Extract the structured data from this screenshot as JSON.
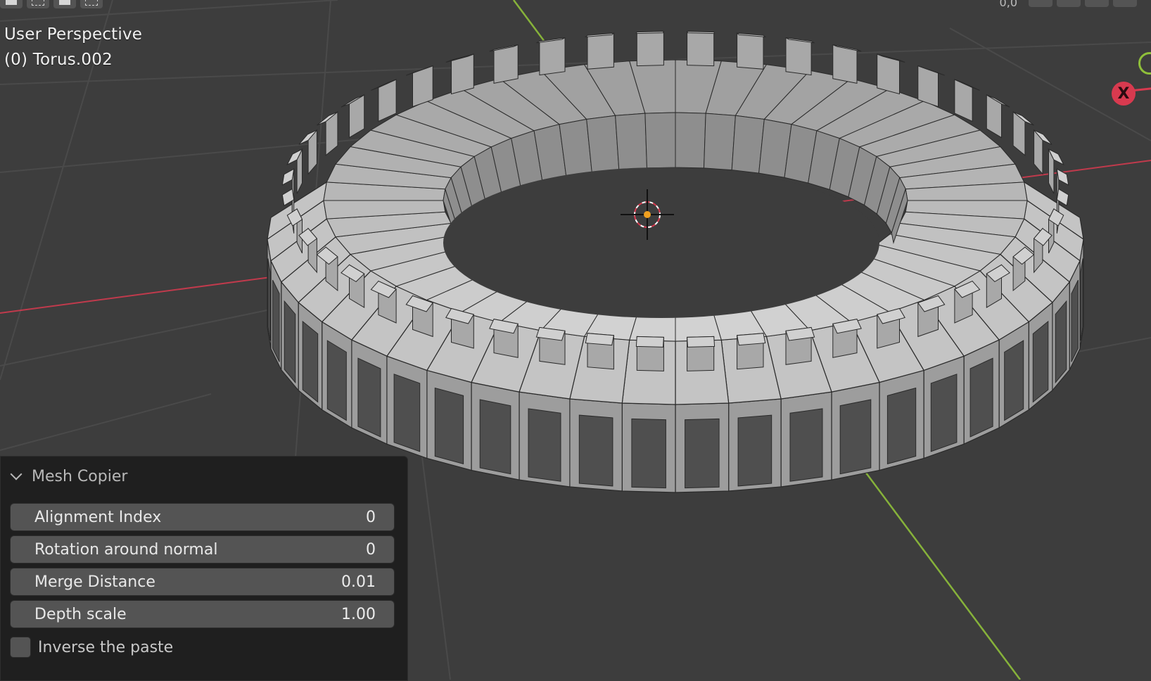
{
  "viewport": {
    "view_name": "User Perspective",
    "object_name": "(0) Torus.002",
    "top_right_readout": "0,0",
    "axis_x_label": "X",
    "icons": {
      "cursor": "3d-cursor-icon",
      "gizmo_x": "axis-x-icon",
      "gizmo_y": "axis-y-icon"
    },
    "colors": {
      "background": "#3d3d3d",
      "axis_x": "#d83a4f",
      "axis_y": "#8fbf3a",
      "grid": "#4a4a4a",
      "mesh_face": "#b9b9b9",
      "mesh_edge": "#2a2a2a"
    }
  },
  "panel": {
    "title": "Mesh Copier",
    "fields": [
      {
        "label": "Alignment Index",
        "value": "0"
      },
      {
        "label": "Rotation around normal",
        "value": "0"
      },
      {
        "label": "Merge Distance",
        "value": "0.01"
      },
      {
        "label": "Depth scale",
        "value": "1.00"
      }
    ],
    "checkbox_label": "Inverse the paste",
    "checkbox_checked": false
  }
}
